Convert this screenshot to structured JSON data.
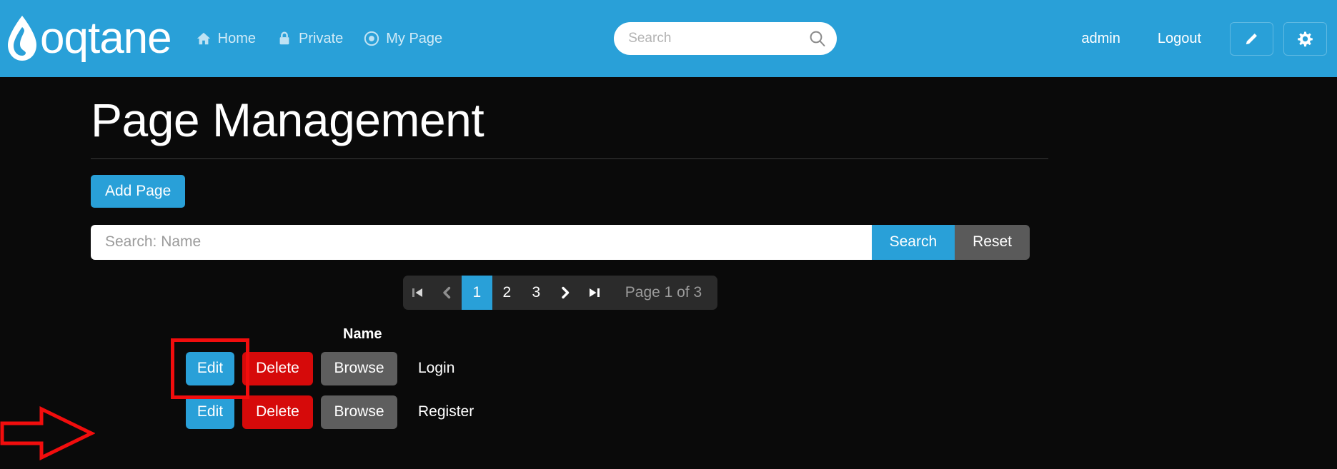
{
  "header": {
    "brand_text": "oqtane",
    "brand_icon": "water-drop-icon",
    "nav": [
      {
        "label": "Home",
        "icon": "home-icon"
      },
      {
        "label": "Private",
        "icon": "lock-icon"
      },
      {
        "label": "My Page",
        "icon": "target-icon"
      }
    ],
    "search": {
      "placeholder": "Search",
      "value": "",
      "icon": "search-icon"
    },
    "user": "admin",
    "logout": "Logout",
    "edit_button_icon": "pencil-icon",
    "settings_button_icon": "gear-icon",
    "bg_color": "#29a0d8"
  },
  "main": {
    "title": "Page Management",
    "add_button": "Add Page",
    "search": {
      "placeholder": "Search: Name",
      "value": "",
      "search_button": "Search",
      "reset_button": "Reset"
    },
    "pager": {
      "first": "first-page-icon",
      "prev": "prev-page-icon",
      "pages": [
        "1",
        "2",
        "3"
      ],
      "active_page": "1",
      "next": "next-page-icon",
      "last": "last-page-icon",
      "status": "Page 1 of 3"
    },
    "table": {
      "columns": [
        "Name"
      ],
      "actions": [
        "Edit",
        "Delete",
        "Browse"
      ],
      "rows": [
        {
          "name": "Login",
          "edit": "Edit",
          "delete": "Delete",
          "browse": "Browse"
        },
        {
          "name": "Register",
          "edit": "Edit",
          "delete": "Delete",
          "browse": "Browse"
        }
      ]
    }
  },
  "annotation": {
    "type": "arrow-pointing-right",
    "target": "Edit",
    "color": "#f20d0d"
  },
  "colors": {
    "accent": "#29a0d8",
    "danger": "#d60a0a",
    "neutral": "#5e5e5e",
    "background": "#0a0a0a",
    "highlight": "#f20d0d"
  }
}
